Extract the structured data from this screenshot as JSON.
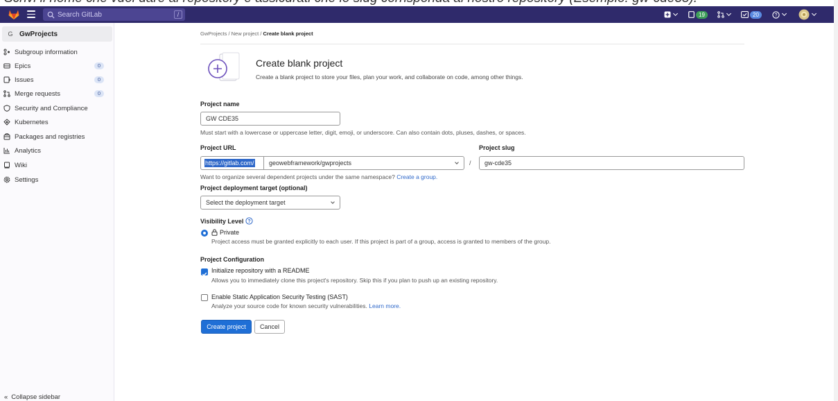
{
  "caption": "Scrivi il nome che vuoi dare al repository e assicurati che lo slug corrisponda al nostro repository (Esempio: gw-cde35).",
  "topbar": {
    "search_placeholder": "Search GitLab",
    "search_shortcut": "/",
    "issues_count": "19",
    "todos_count": "20"
  },
  "sidebar": {
    "group_avatar": "G",
    "group_name": "GwProjects",
    "items": [
      {
        "label": "Subgroup information",
        "icon": "subgroup-icon"
      },
      {
        "label": "Epics",
        "icon": "epic-icon",
        "count": "0"
      },
      {
        "label": "Issues",
        "icon": "issues-icon",
        "count": "0"
      },
      {
        "label": "Merge requests",
        "icon": "merge-request-icon",
        "count": "0"
      },
      {
        "label": "Security and Compliance",
        "icon": "shield-icon"
      },
      {
        "label": "Kubernetes",
        "icon": "kubernetes-icon"
      },
      {
        "label": "Packages and registries",
        "icon": "package-icon"
      },
      {
        "label": "Analytics",
        "icon": "analytics-icon"
      },
      {
        "label": "Wiki",
        "icon": "wiki-icon"
      },
      {
        "label": "Settings",
        "icon": "settings-icon"
      }
    ],
    "collapse_label": "Collapse sidebar"
  },
  "breadcrumb": {
    "items": [
      "GwProjects",
      "New project",
      "Create blank project"
    ]
  },
  "hero": {
    "title": "Create blank project",
    "description": "Create a blank project to store your files, plan your work, and collaborate on code, among other things."
  },
  "form": {
    "project_name_label": "Project name",
    "project_name_value": "GW CDE35",
    "project_name_help": "Must start with a lowercase or uppercase letter, digit, emoji, or underscore. Can also contain dots, pluses, dashes, or spaces.",
    "project_url_label": "Project URL",
    "url_prefix": "https://gitlab.com/",
    "namespace_value": "geowebframework/gwprojects",
    "slug_label": "Project slug",
    "slug_value": "gw-cde35",
    "url_help": "Want to organize several dependent projects under the same namespace?",
    "url_help_link": "Create a group.",
    "deployment_label": "Project deployment target (optional)",
    "deployment_placeholder": "Select the deployment target",
    "visibility_label": "Visibility Level",
    "visibility_option": "Private",
    "visibility_desc": "Project access must be granted explicitly to each user. If this project is part of a group, access is granted to members of the group.",
    "config_label": "Project Configuration",
    "readme_label": "Initialize repository with a README",
    "readme_desc": "Allows you to immediately clone this project's repository. Skip this if you plan to push up an existing repository.",
    "sast_label": "Enable Static Application Security Testing (SAST)",
    "sast_desc": "Analyze your source code for known security vulnerabilities.",
    "sast_link": "Learn more.",
    "create_button": "Create project",
    "cancel_button": "Cancel"
  },
  "colors": {
    "navbar": "#2f2a6b",
    "primary": "#1f6fd6",
    "link": "#2d67c9"
  }
}
